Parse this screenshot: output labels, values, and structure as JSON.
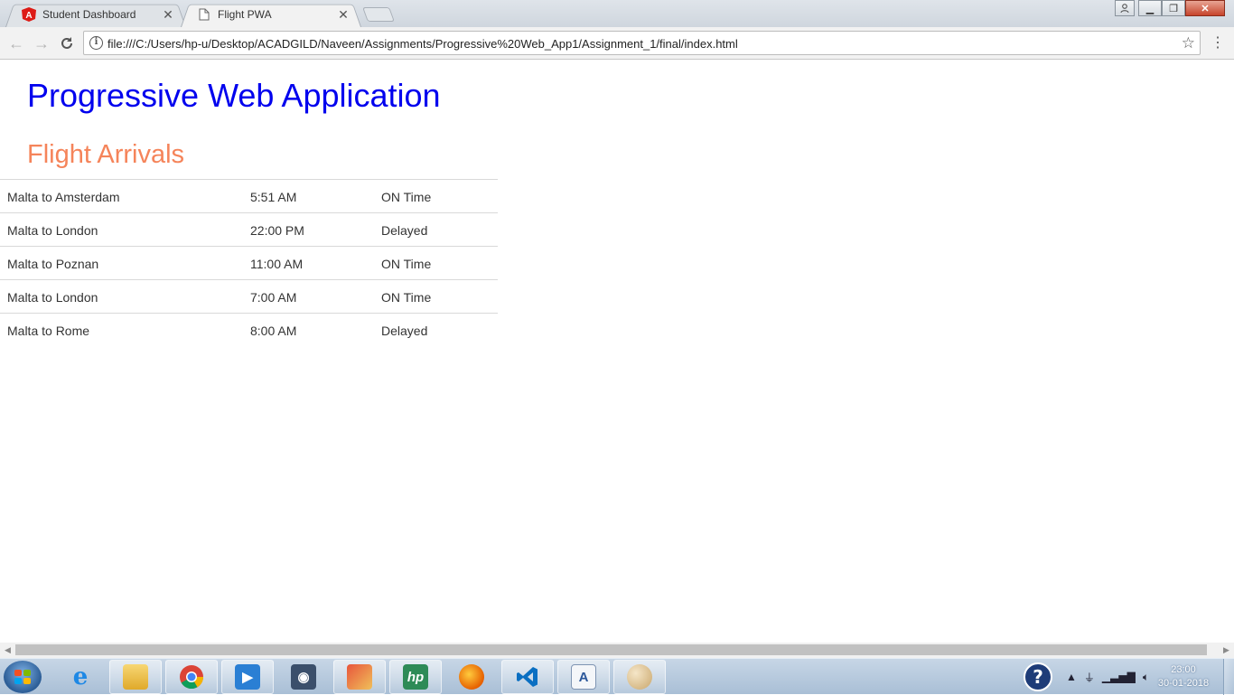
{
  "browser": {
    "tabs": [
      {
        "title": "Student Dashboard",
        "icon": "angular-icon",
        "active": false
      },
      {
        "title": "Flight PWA",
        "icon": "page-icon",
        "active": true
      }
    ],
    "address": "file:///C:/Users/hp-u/Desktop/ACADGILD/Naveen/Assignments/Progressive%20Web_App1/Assignment_1/final/index.html"
  },
  "page": {
    "heading": "Progressive Web Application",
    "subheading": "Flight Arrivals",
    "heading_color": "#0000ee",
    "subheading_color": "#f5845a",
    "flights": [
      {
        "route": "Malta to Amsterdam",
        "time": "5:51 AM",
        "status": "ON Time"
      },
      {
        "route": "Malta to London",
        "time": "22:00 PM",
        "status": "Delayed"
      },
      {
        "route": "Malta to Poznan",
        "time": "11:00 AM",
        "status": "ON Time"
      },
      {
        "route": "Malta to London",
        "time": "7:00 AM",
        "status": "ON Time"
      },
      {
        "route": "Malta to Rome",
        "time": "8:00 AM",
        "status": "Delayed"
      }
    ]
  },
  "taskbar": {
    "apps": [
      "internet-explorer-icon",
      "file-explorer-icon",
      "chrome-icon",
      "media-player-icon",
      "camera-app-icon",
      "paint-app-icon",
      "hp-app-icon",
      "firefox-icon",
      "visual-studio-code-icon",
      "document-app-icon",
      "paint-palette-icon"
    ],
    "time": "23:00",
    "date": "30-01-2018"
  }
}
